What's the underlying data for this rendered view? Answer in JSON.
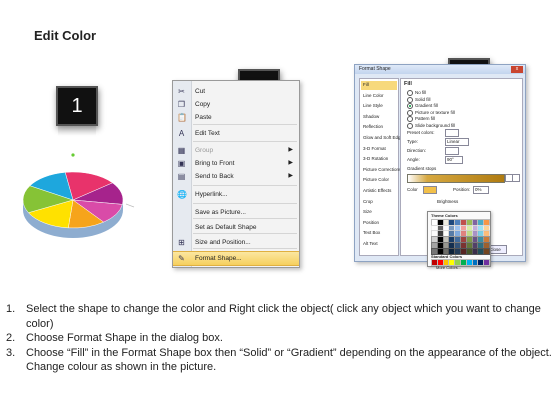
{
  "title": "Edit Color",
  "steps": {
    "s1": "1",
    "s2": "2",
    "s3": "3"
  },
  "pie_colors": [
    "#e8336b",
    "#a6238c",
    "#d94ba8",
    "#f6a41b",
    "#ffe100",
    "#86c336",
    "#1ea7dd"
  ],
  "context_menu": {
    "items": [
      {
        "label": "Cut",
        "icon": "scissors-icon",
        "glyph": "✂"
      },
      {
        "label": "Copy",
        "icon": "copy-icon",
        "glyph": "❐"
      },
      {
        "label": "Paste",
        "icon": "paste-icon",
        "glyph": "📋"
      },
      {
        "label": "Edit Text",
        "icon": "edit-text-icon",
        "glyph": "A"
      },
      {
        "label": "Group",
        "icon": "group-icon",
        "glyph": "▦"
      },
      {
        "label": "Bring to Front",
        "icon": "bring-front-icon",
        "glyph": "▣"
      },
      {
        "label": "Send to Back",
        "icon": "send-back-icon",
        "glyph": "▤"
      },
      {
        "label": "Hyperlink...",
        "icon": "hyperlink-icon",
        "glyph": "🌐"
      },
      {
        "label": "Save as Picture...",
        "icon": "",
        "glyph": ""
      },
      {
        "label": "Set as Default Shape",
        "icon": "",
        "glyph": ""
      },
      {
        "label": "Size and Position...",
        "icon": "size-icon",
        "glyph": "⊞"
      },
      {
        "label": "Format Shape...",
        "icon": "format-shape-icon",
        "glyph": "✎"
      }
    ]
  },
  "dialog": {
    "title": "Format Shape",
    "close": "x",
    "nav": [
      "Fill",
      "Line Color",
      "Line Style",
      "Shadow",
      "Reflection",
      "Glow and Soft Edges",
      "3-D Format",
      "3-D Rotation",
      "Picture Corrections",
      "Picture Color",
      "Artistic Effects",
      "Crop",
      "Size",
      "Position",
      "Text Box",
      "Alt Text"
    ],
    "pane_title": "Fill",
    "options": [
      "No fill",
      "Solid fill",
      "Gradient fill",
      "Picture or texture fill",
      "Pattern fill",
      "Slide background fill"
    ],
    "fields": [
      "Preset colors:",
      "Type:",
      "Direction:",
      "Angle:",
      "Gradient stops"
    ],
    "type_value": "Linear",
    "angle_value": "90°",
    "color_label": "Color",
    "position_label": "Position:",
    "position_value": "0%",
    "brightness_label": "Brightness",
    "transparency_label": "Transparency",
    "rotate_label": "Rotate with shape",
    "close_button": "Close"
  },
  "color_popup": {
    "theme_label": "Theme Colors",
    "standard_label": "Standard Colors",
    "more_label": "More Colors...",
    "theme": [
      "#ffffff",
      "#000000",
      "#eeece1",
      "#1f497d",
      "#4f81bd",
      "#c0504d",
      "#9bbb59",
      "#8064a2",
      "#4bacc6",
      "#f79646"
    ],
    "standard": [
      "#c00000",
      "#ff0000",
      "#ffc000",
      "#ffff00",
      "#92d050",
      "#00b050",
      "#00b0f0",
      "#0070c0",
      "#002060",
      "#7030a0"
    ]
  },
  "instructions": [
    {
      "num": "1.",
      "text": "Select the shape to change the color and Right click the object( click any object which you want to change color)"
    },
    {
      "num": "2.",
      "text": "Choose Format Shape in the dialog box."
    },
    {
      "num": "3.",
      "text": "Choose “Fill” in the Format Shape box then “Solid” or “Gradient” depending on the appearance of the object. Change colour as shown in the picture."
    }
  ]
}
